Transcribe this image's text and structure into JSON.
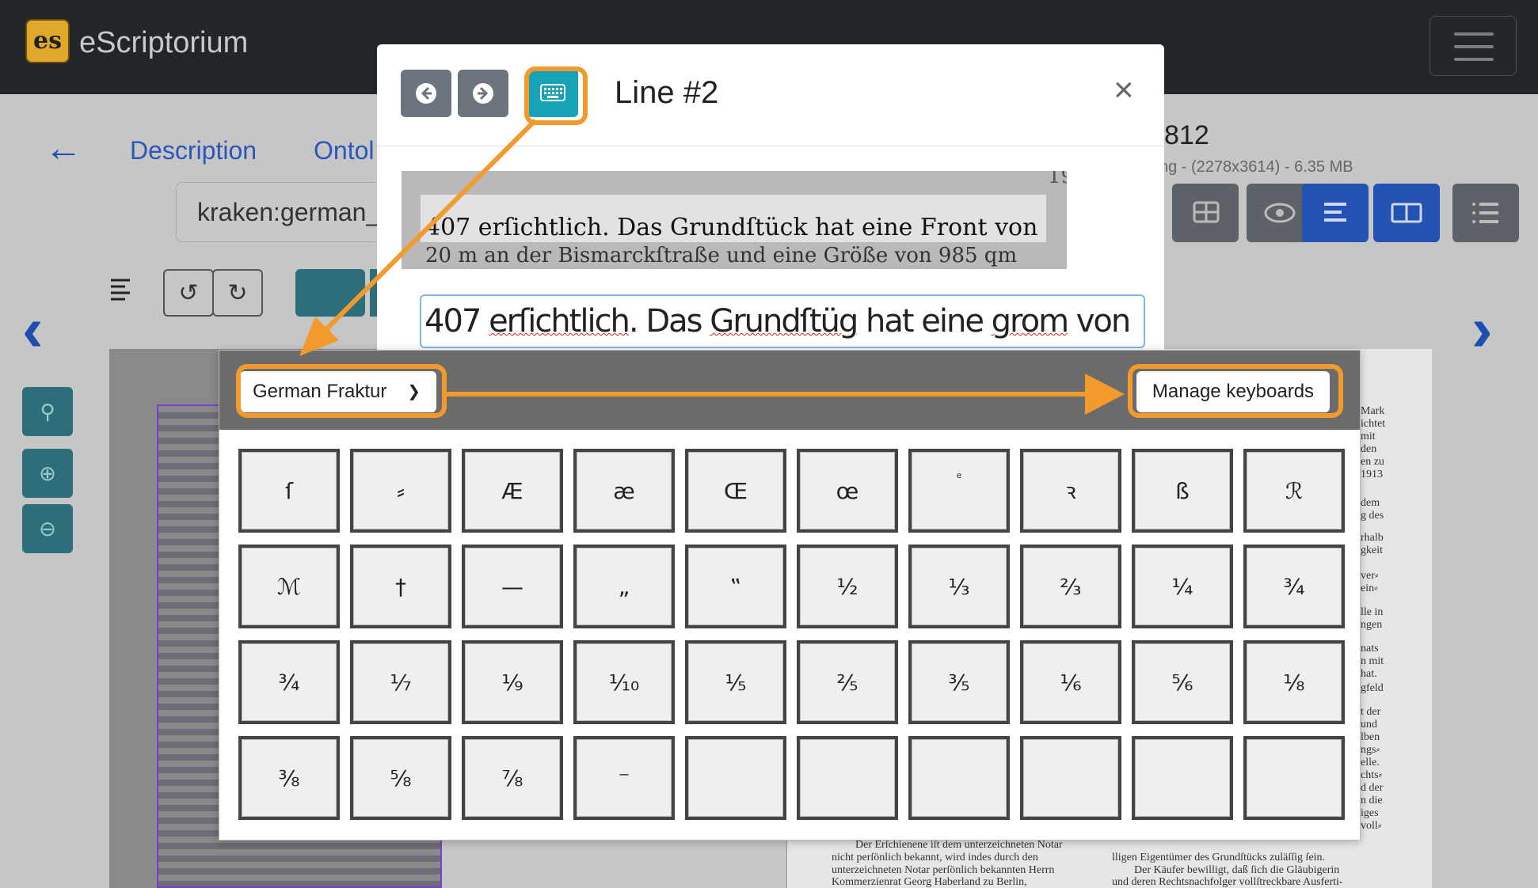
{
  "navbar": {
    "brand": "eScriptorium",
    "logo_text": "es"
  },
  "page": {
    "tabs": [
      "Description",
      "Ontol"
    ],
    "model_value": "kraken:german_",
    "doc_title": "812",
    "doc_meta": "ng - (2278x3614) - 6.35 MB"
  },
  "modal": {
    "title": "Line #2",
    "close": "×",
    "image_line1": "407 erſichtlich.  Das Grundſtück hat eine Front von",
    "image_line2": "20 m an der Bismarckſtraße und eine Größe von 985 qm",
    "image_page_num": "19",
    "transcription": {
      "p1": "407 ",
      "w1": "erſichtlich",
      "p2": ". Das ",
      "w2": "Grundſtüg",
      "p3": " hat eine ",
      "w3": "grom",
      "p4": " von"
    }
  },
  "keyboard": {
    "layout": "German Fraktur",
    "manage": "Manage keyboards",
    "keys": [
      "ſ",
      "⸗",
      "Æ",
      "æ",
      "Œ",
      "œ",
      "ͤ",
      "ꝛ",
      "ß",
      "ℛ",
      "ℳ",
      "†",
      "—",
      "„",
      "‟",
      "½",
      "⅓",
      "⅔",
      "¼",
      "¾",
      "¾",
      "⅐",
      "⅑",
      "⅒",
      "⅕",
      "⅖",
      "⅗",
      "⅙",
      "⅚",
      "⅛",
      "⅜",
      "⅝",
      "⅞",
      "⁻",
      "",
      "",
      "",
      "",
      "",
      ""
    ]
  },
  "right_page_lines": [
    "Mark",
    "ichtet",
    "mit",
    "den",
    "en zu",
    "1913",
    "dem",
    "g des",
    "rhalb",
    "gkeit",
    "ver⸗",
    "ein⸗",
    "lle in",
    "ngen",
    "nats",
    "n mit",
    "hat.",
    "gfeld",
    "t der",
    "und",
    "lben",
    "ngs⸗",
    "elle.",
    "chts⸗",
    "d der",
    "n die",
    "iges",
    "voll⸗"
  ],
  "right_page_bottom": [
    "Der Erſchienene iſt dem unterzeichneten Notar",
    "nicht perſönlich bekannt, wird indes durch den",
    "unterzeichneten Notar perſönlich bekannten Herrn",
    "Kommerzienrat Georg Haberland zu Berlin,",
    "lligen Eigentümer des Grundſtücks zuläſſig ſein.",
    "Der Käufer bewilligt, daß ſich die Gläubigerin",
    "und deren Rechtsnachfolger vollſtreckbare Ausferti-"
  ],
  "colors": {
    "accent": "#f29a2e",
    "primary": "#2b57b8",
    "info": "#17a2b8",
    "navbar": "#222529"
  }
}
